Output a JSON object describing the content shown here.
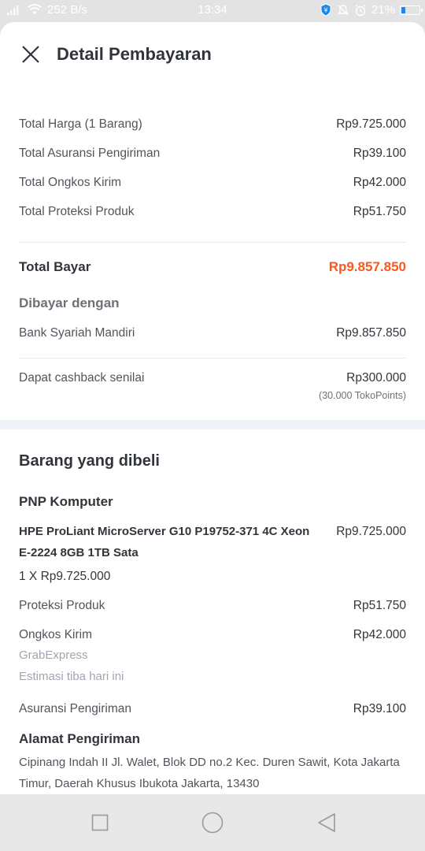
{
  "status_bar": {
    "net_speed": "252 B/s",
    "time": "13:34",
    "battery": "21%"
  },
  "header": {
    "title": "Detail Pembayaran"
  },
  "summary": {
    "rows": [
      {
        "label": "Total Harga (1 Barang)",
        "value": "Rp9.725.000"
      },
      {
        "label": "Total Asuransi Pengiriman",
        "value": "Rp39.100"
      },
      {
        "label": "Total Ongkos Kirim",
        "value": "Rp42.000"
      },
      {
        "label": "Total Proteksi Produk",
        "value": "Rp51.750"
      }
    ],
    "total_label": "Total Bayar",
    "total_value": "Rp9.857.850",
    "paid_with_title": "Dibayar dengan",
    "payment_method": "Bank Syariah Mandiri",
    "payment_value": "Rp9.857.850",
    "cashback_label": "Dapat cashback senilai",
    "cashback_value": "Rp300.000",
    "cashback_points": "(30.000 TokoPoints)"
  },
  "purchased": {
    "title": "Barang yang dibeli",
    "shop": "PNP Komputer",
    "product_name": "HPE ProLiant MicroServer G10 P19752-371 4C Xeon E-2224 8GB 1TB Sata",
    "product_price": "Rp9.725.000",
    "quantity": "1 X Rp9.725.000",
    "protection_label": "Proteksi Produk",
    "protection_value": "Rp51.750",
    "shipping_label": "Ongkos Kirim",
    "shipping_value": "Rp42.000",
    "courier": "GrabExpress",
    "eta": "Estimasi tiba hari ini",
    "insurance_label": "Asuransi Pengiriman",
    "insurance_value": "Rp39.100"
  },
  "address": {
    "title": "Alamat Pengiriman",
    "text": "Cipinang Indah II Jl. Walet, Blok DD no.2 Kec. Duren Sawit, Kota Jakarta Timur, Daerah Khusus Ibukota Jakarta, 13430"
  },
  "colors": {
    "accent": "#fa591d",
    "text": "#31353b",
    "divider": "#e6e8eb"
  },
  "icons": {
    "close": "close-icon",
    "nav_recent": "square-icon",
    "nav_home": "circle-icon",
    "nav_back": "triangle-back-icon"
  }
}
